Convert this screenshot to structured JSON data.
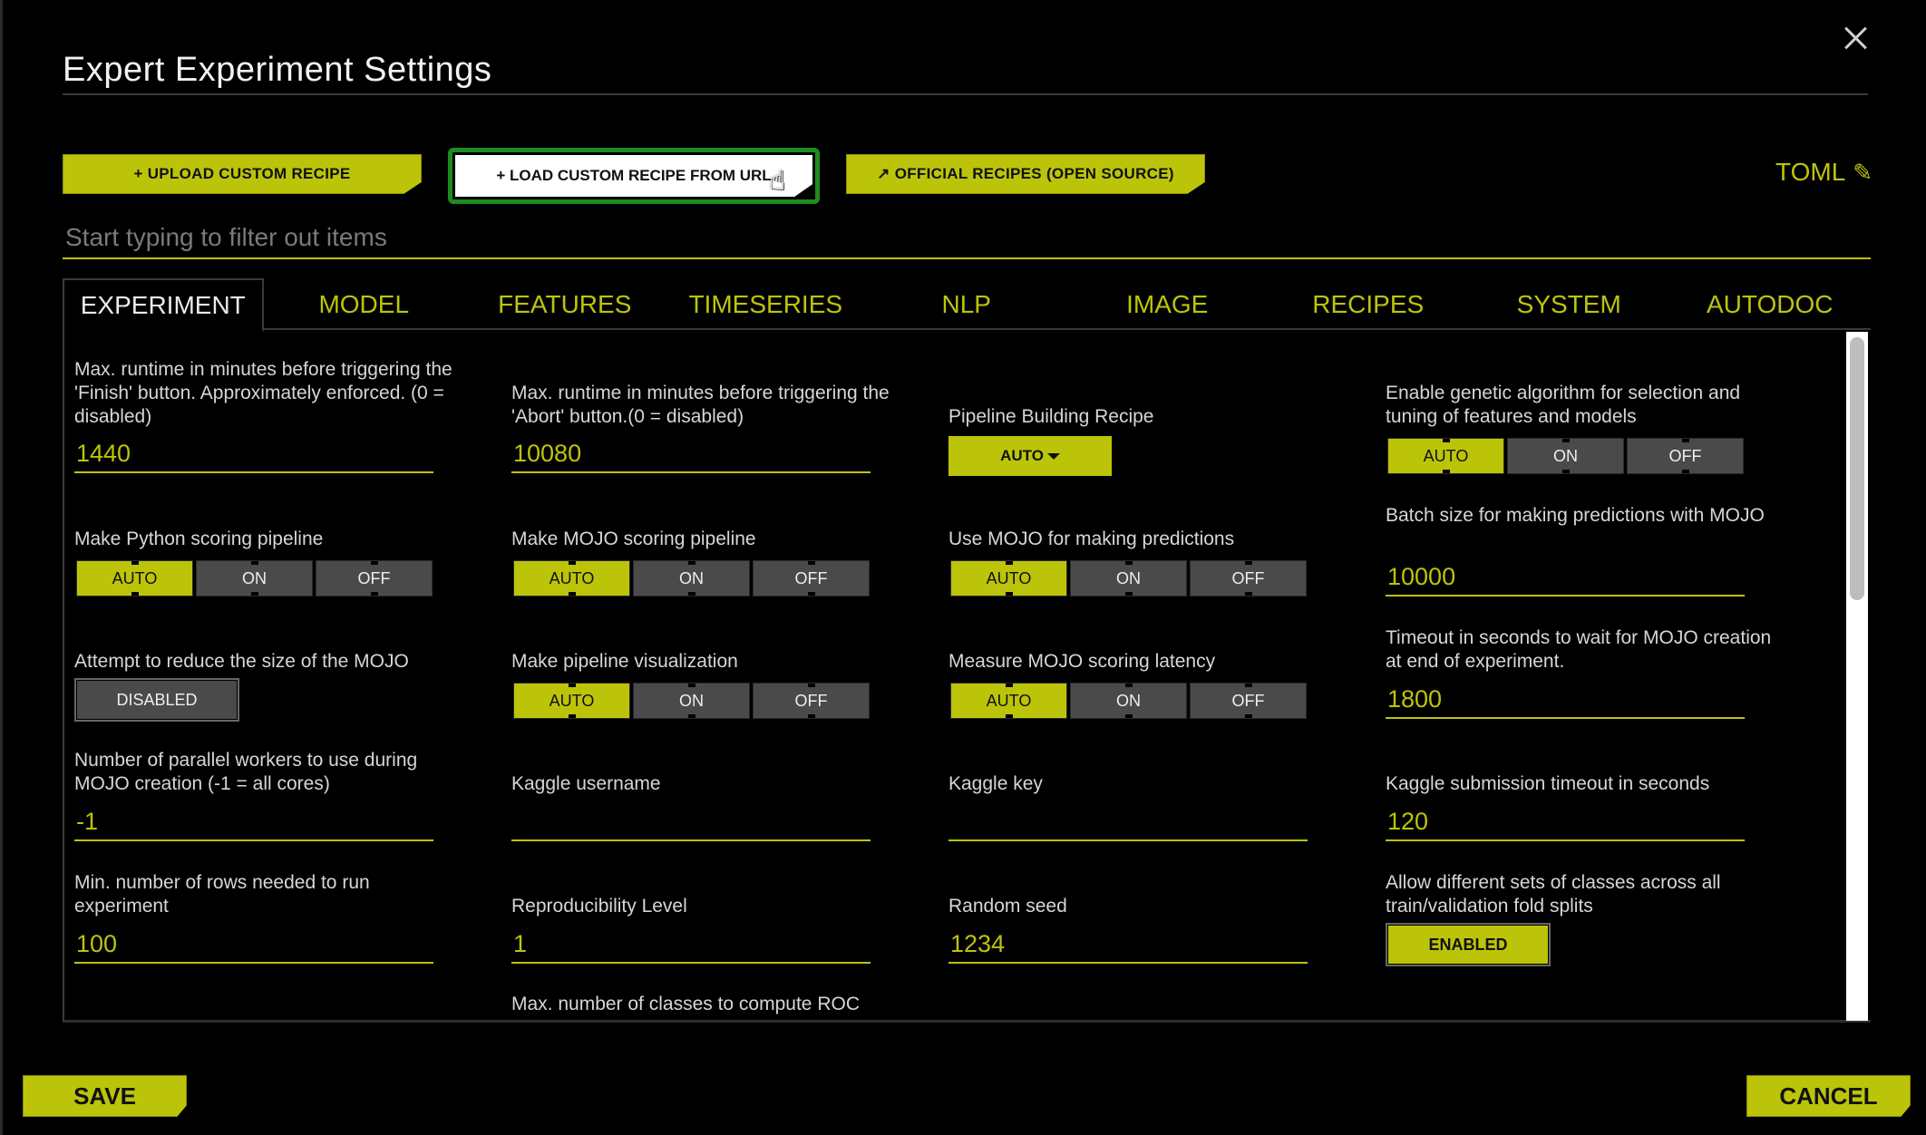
{
  "dialog": {
    "title": "Expert Experiment Settings",
    "close_icon": "close-icon"
  },
  "toolbar": {
    "upload_label": "+ UPLOAD CUSTOM RECIPE",
    "load_url_label": "+ LOAD CUSTOM RECIPE FROM URL",
    "official_label": "↗ OFFICIAL RECIPES (OPEN SOURCE)",
    "toml_label": "TOML",
    "toml_icon": "✎"
  },
  "filter": {
    "placeholder": "Start typing to filter out items",
    "value": ""
  },
  "tabs": [
    {
      "label": "EXPERIMENT",
      "active": true
    },
    {
      "label": "MODEL"
    },
    {
      "label": "FEATURES"
    },
    {
      "label": "TIMESERIES"
    },
    {
      "label": "NLP"
    },
    {
      "label": "IMAGE"
    },
    {
      "label": "RECIPES"
    },
    {
      "label": "SYSTEM"
    },
    {
      "label": "AUTODOC"
    }
  ],
  "segment_options": [
    "AUTO",
    "ON",
    "OFF"
  ],
  "settings": {
    "max_runtime_finish": {
      "label": "Max. runtime in minutes before triggering the 'Finish' button. Approximately enforced. (0 = disabled)",
      "value": "1440"
    },
    "max_runtime_abort": {
      "label": "Max. runtime in minutes before triggering the 'Abort' button.(0 = disabled)",
      "value": "10080"
    },
    "pipeline_recipe": {
      "label": "Pipeline Building Recipe",
      "value": "AUTO"
    },
    "genetic_algorithm": {
      "label": "Enable genetic algorithm for selection and tuning of features and models",
      "selected": "AUTO"
    },
    "python_scoring": {
      "label": "Make Python scoring pipeline",
      "selected": "AUTO"
    },
    "mojo_scoring": {
      "label": "Make MOJO scoring pipeline",
      "selected": "AUTO"
    },
    "mojo_predictions": {
      "label": "Use MOJO for making predictions",
      "selected": "AUTO"
    },
    "mojo_batch_size": {
      "label": "Batch size for making predictions with MOJO",
      "value": "10000"
    },
    "reduce_mojo": {
      "label": "Attempt to reduce the size of the MOJO",
      "value": "DISABLED"
    },
    "pipeline_viz": {
      "label": "Make pipeline visualization",
      "selected": "AUTO"
    },
    "mojo_latency": {
      "label": "Measure MOJO scoring latency",
      "selected": "AUTO"
    },
    "mojo_timeout": {
      "label": "Timeout in seconds to wait for MOJO creation at end of experiment.",
      "value": "1800"
    },
    "mojo_workers": {
      "label": "Number of parallel workers to use during MOJO creation (-1 = all cores)",
      "value": "-1"
    },
    "kaggle_username": {
      "label": "Kaggle username",
      "value": ""
    },
    "kaggle_key": {
      "label": "Kaggle key",
      "value": ""
    },
    "kaggle_timeout": {
      "label": "Kaggle submission timeout in seconds",
      "value": "120"
    },
    "min_rows": {
      "label": "Min. number of rows needed to run experiment",
      "value": "100"
    },
    "reproducibility": {
      "label": "Reproducibility Level",
      "value": "1"
    },
    "random_seed": {
      "label": "Random seed",
      "value": "1234"
    },
    "allow_diff_classes": {
      "label": "Allow different sets of classes across all train/validation fold splits",
      "value": "ENABLED"
    },
    "max_classes_roc": {
      "label": "Max. number of classes to compute ROC"
    }
  },
  "footer": {
    "save_label": "SAVE",
    "cancel_label": "CANCEL"
  },
  "colors": {
    "accent": "#bcc40a",
    "focus_ring": "#1e8b1e",
    "segment_off": "#4a4a4a",
    "background": "#000000"
  }
}
